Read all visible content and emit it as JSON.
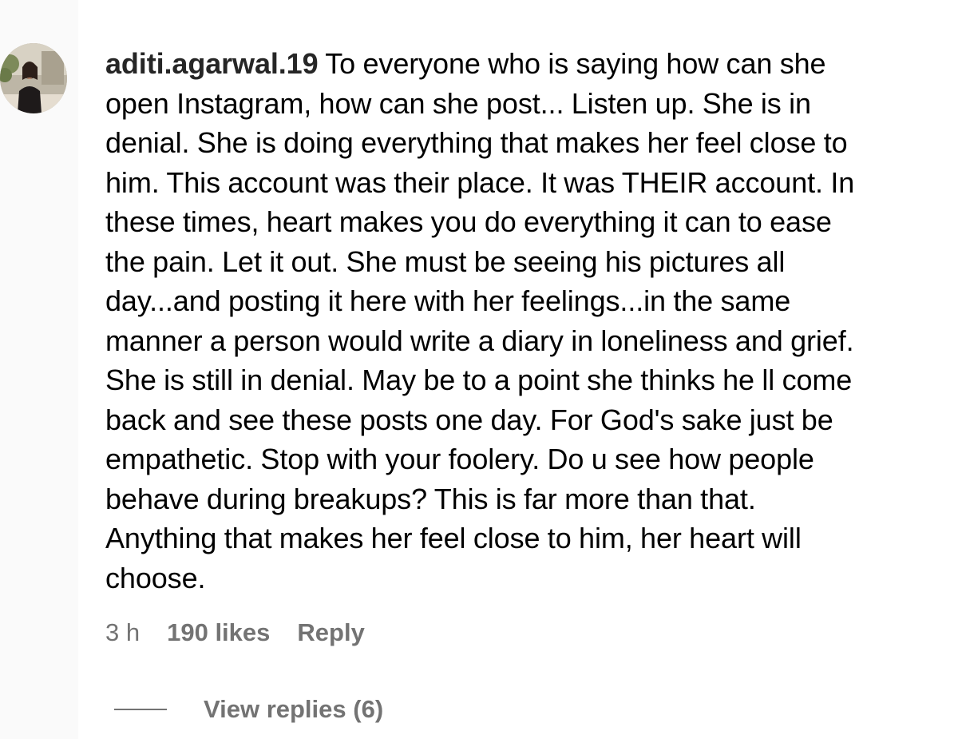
{
  "comment": {
    "username": "aditi.agarwal.19",
    "lines": [
      " To everyone who is saying how can she",
      "open Instagram, how can she post... Listen up. She is in",
      "denial. She is doing everything that makes her feel close to",
      "him. This account was their place. It was THEIR account. In",
      "these times, heart makes you do everything it can to ease",
      "the pain. Let it out. She must be seeing his pictures all",
      "day...and posting it here with her feelings...in the same",
      "manner a person would write a diary in loneliness and grief.",
      "She is still in denial. May be to a point she thinks he ll come",
      "back and see these posts one day. For God's sake just be",
      "empathetic. Stop with your foolery. Do u see how people",
      "behave during breakups? This is far more than that.",
      "Anything that makes her feel close to him, her heart will",
      "choose."
    ],
    "time": "3 h",
    "likes": "190 likes",
    "reply_label": "Reply",
    "view_replies_label": "View replies (6)"
  },
  "colors": {
    "text": "#000000",
    "username": "#262626",
    "secondary": "#737373",
    "background": "#ffffff"
  },
  "icons": {
    "avatar": "profile-photo"
  }
}
